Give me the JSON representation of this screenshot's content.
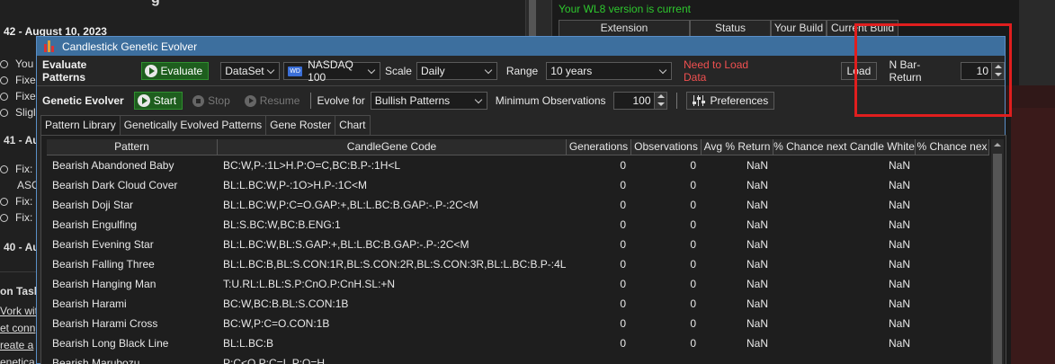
{
  "background": {
    "title_fragment": "g",
    "date_heading": "42 - August 10, 2023",
    "left_lines": [
      {
        "prefix": "You",
        "radio": true
      },
      {
        "prefix": "Fixe",
        "radio": true
      },
      {
        "prefix": "Fixe",
        "radio": true
      },
      {
        "prefix": "Sligl",
        "radio": true
      }
    ],
    "heading_41": "41 - Au",
    "lines_41": [
      {
        "prefix": "Fix:",
        "radio": true
      },
      {
        "prefix": "ASC",
        "radio": false
      },
      {
        "prefix": "Fix:",
        "radio": true
      },
      {
        "prefix": "Fix:",
        "radio": true
      }
    ],
    "heading_40": "40 - Au",
    "task_heading": "on Task",
    "links": [
      "Vork wit",
      "et conn",
      "reate a",
      "enetica"
    ],
    "version_text": "Your WL8 version is current",
    "ext_columns": [
      "Extension",
      "Status",
      "Your Build",
      "Current Build"
    ]
  },
  "dialog": {
    "title": "Candlestick Genetic Evolver",
    "evaluate_label": "Evaluate Patterns",
    "evaluate_button": "Evaluate",
    "dataset_select": "DataSet",
    "dataset_badge": "WD",
    "symbol_select": "NASDAQ 100",
    "scale_label": "Scale",
    "scale_select": "Daily",
    "range_label": "Range",
    "range_select": "10 years",
    "warning": "Need to Load Data",
    "load_button": "Load",
    "nbar_label": "N Bar-Return",
    "nbar_value": "10",
    "evolver_label": "Genetic Evolver",
    "start_button": "Start",
    "stop_button": "Stop",
    "resume_button": "Resume",
    "evolve_for_label": "Evolve for",
    "evolve_for_select": "Bullish Patterns",
    "min_obs_label": "Minimum Observations",
    "min_obs_value": "100",
    "preferences_button": "Preferences"
  },
  "tabs": [
    "Pattern Library",
    "Genetically Evolved Patterns",
    "Gene Roster",
    "Chart"
  ],
  "table": {
    "headers": [
      "Pattern",
      "CandleGene Code",
      "Generations",
      "Observations",
      "Avg % Return",
      "% Chance next Candle White",
      "% Chance nex"
    ],
    "rows": [
      {
        "pattern": "Bearish Abandoned Baby",
        "code": "BC:W,P-:1L>H.P:O=C,BC:B.P-:1H<L",
        "gen": "0",
        "obs": "0",
        "avg": "NaN",
        "white": "NaN"
      },
      {
        "pattern": "Bearish Dark Cloud Cover",
        "code": "BL:L.BC:W,P-:1O>H.P-:1C<M",
        "gen": "0",
        "obs": "0",
        "avg": "NaN",
        "white": "NaN"
      },
      {
        "pattern": "Bearish Doji Star",
        "code": "BL:L.BC:W,P:C=O.GAP:+,BL:L.BC:B.GAP:-.P-:2C<M",
        "gen": "0",
        "obs": "0",
        "avg": "NaN",
        "white": "NaN"
      },
      {
        "pattern": "Bearish Engulfing",
        "code": "BL:S.BC:W,BC:B.ENG:1",
        "gen": "0",
        "obs": "0",
        "avg": "NaN",
        "white": "NaN"
      },
      {
        "pattern": "Bearish Evening Star",
        "code": "BL:L.BC:W,BL:S.GAP:+,BL:L.BC:B.GAP:-.P-:2C<M",
        "gen": "0",
        "obs": "0",
        "avg": "NaN",
        "white": "NaN"
      },
      {
        "pattern": "Bearish Falling Three",
        "code": "BL:L.BC:B,BL:S.CON:1R,BL:S.CON:2R,BL:S.CON:3R,BL:L.BC:B.P-:4L<L",
        "gen": "0",
        "obs": "0",
        "avg": "NaN",
        "white": "NaN"
      },
      {
        "pattern": "Bearish Hanging Man",
        "code": "T:U.RL:L.BL:S.P:CnO.P:CnH.SL:+N",
        "gen": "0",
        "obs": "0",
        "avg": "NaN",
        "white": "NaN"
      },
      {
        "pattern": "Bearish Harami",
        "code": "BC:W,BC:B.BL:S.CON:1B",
        "gen": "0",
        "obs": "0",
        "avg": "NaN",
        "white": "NaN"
      },
      {
        "pattern": "Bearish Harami Cross",
        "code": "BC:W,P:C=O.CON:1B",
        "gen": "0",
        "obs": "0",
        "avg": "NaN",
        "white": "NaN"
      },
      {
        "pattern": "Bearish Long Black Line",
        "code": "BL:L.BC:B",
        "gen": "0",
        "obs": "0",
        "avg": "NaN",
        "white": "NaN"
      },
      {
        "pattern": "Bearish Marubozu",
        "code": "P:C<O.P:C=L.P:O=H",
        "gen": "",
        "obs": "",
        "avg": "",
        "white": ""
      }
    ]
  }
}
